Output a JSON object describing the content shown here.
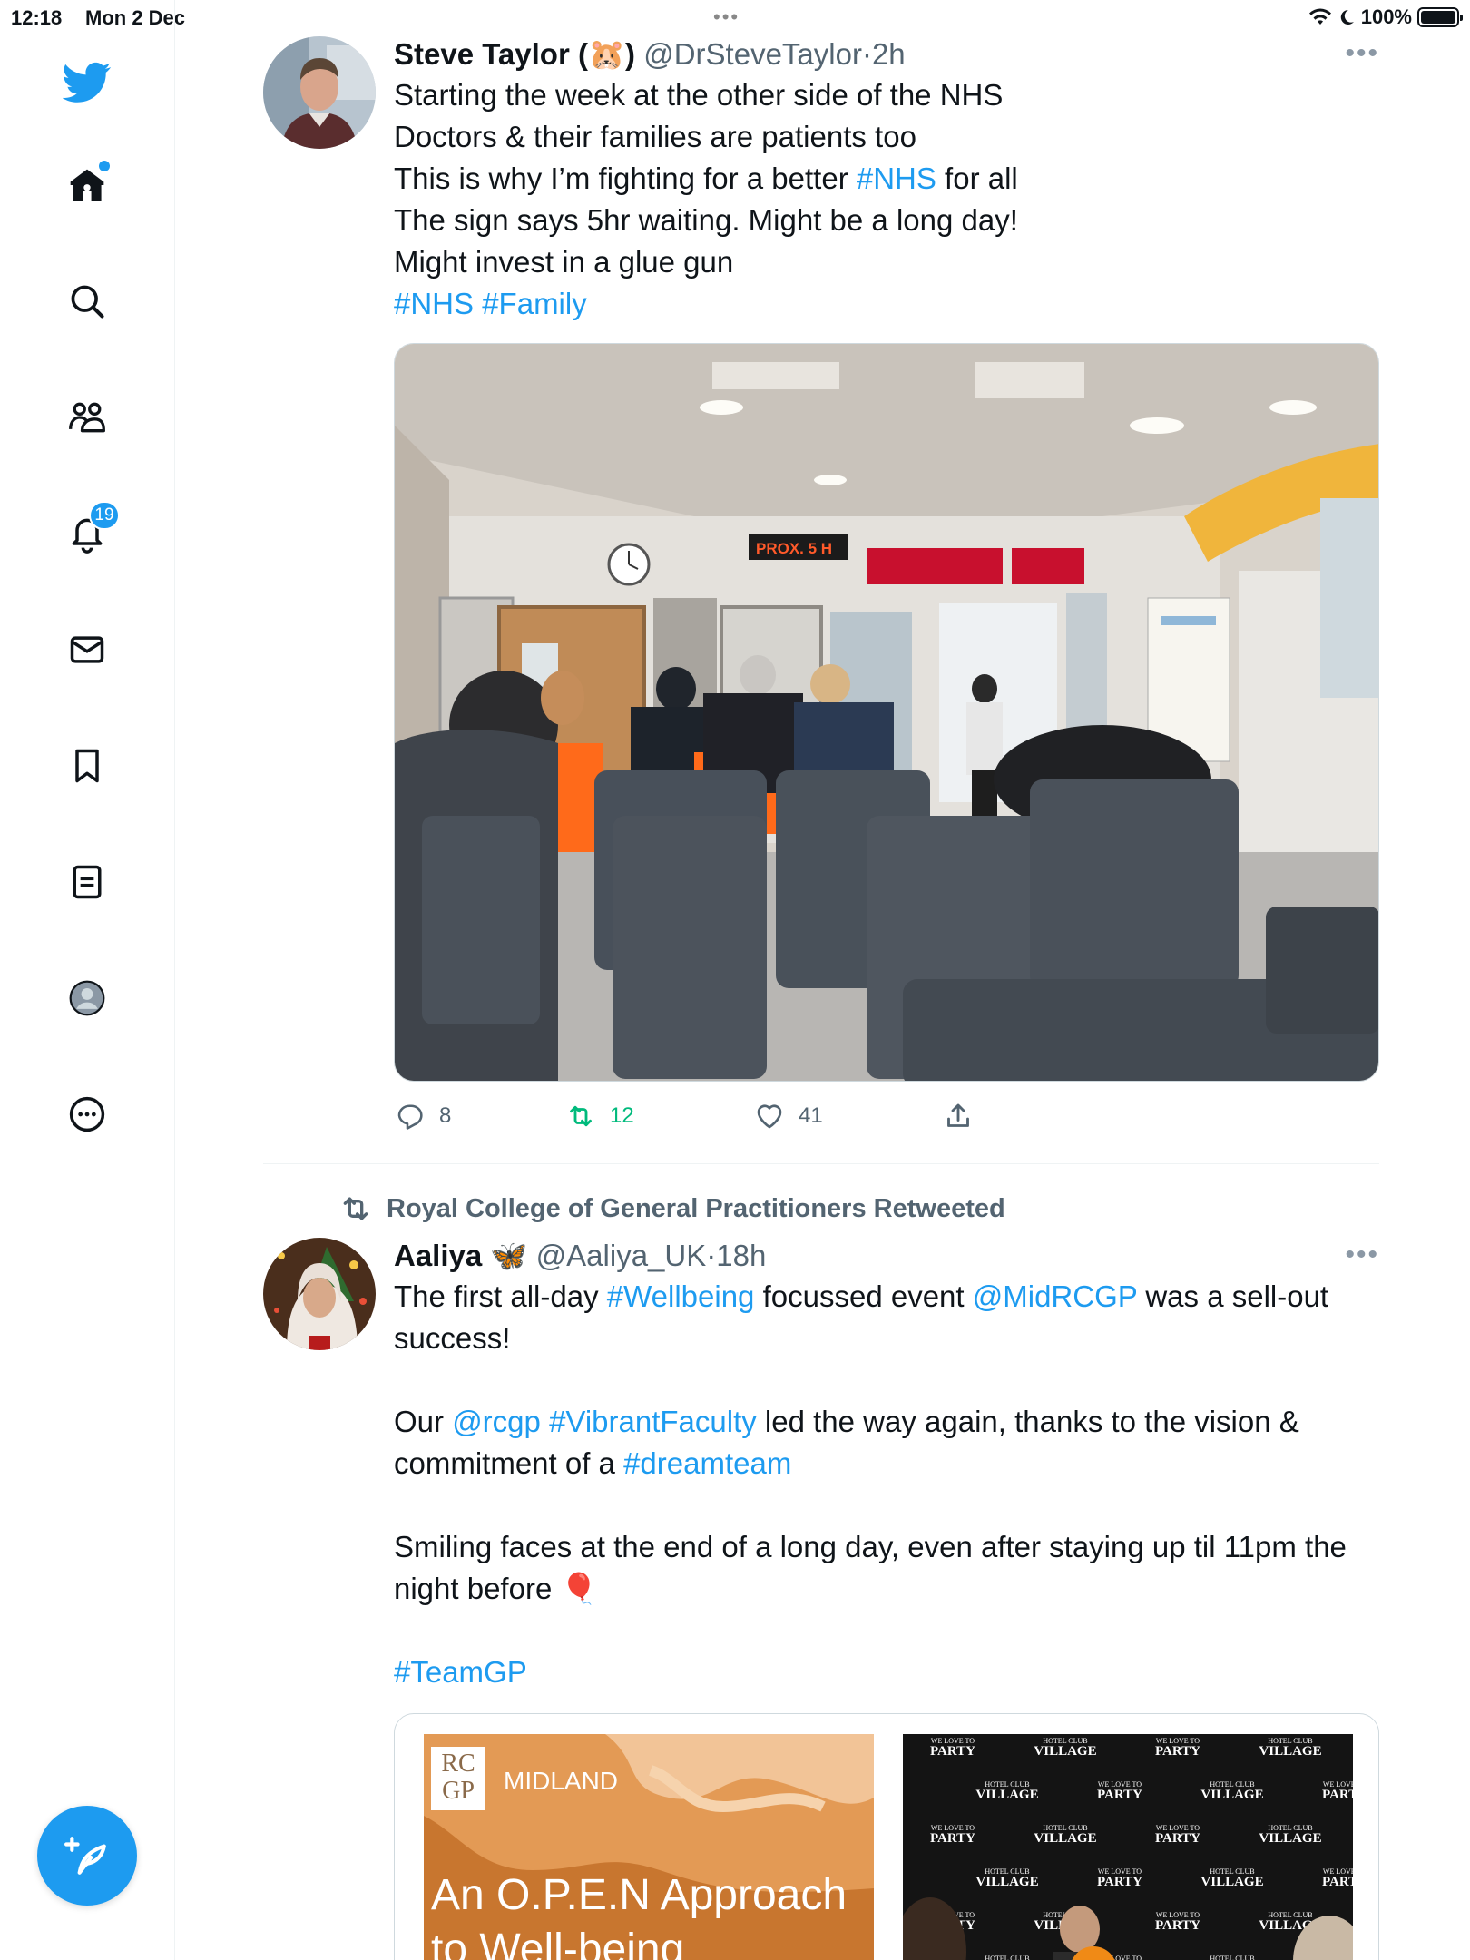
{
  "status_bar": {
    "time": "12:18",
    "date": "Mon 2 Dec",
    "battery": "100%",
    "dots": "•••"
  },
  "sidebar": {
    "items": [
      {
        "name": "twitter-logo-icon"
      },
      {
        "name": "home-icon"
      },
      {
        "name": "search-icon"
      },
      {
        "name": "communities-icon"
      },
      {
        "name": "notifications-icon",
        "badge": "19"
      },
      {
        "name": "messages-icon"
      },
      {
        "name": "bookmarks-icon"
      },
      {
        "name": "lists-icon"
      },
      {
        "name": "profile-icon"
      },
      {
        "name": "more-icon"
      }
    ],
    "compose_icon": "compose-icon"
  },
  "colors": {
    "accent": "#1d9bf0",
    "retweet": "#00ba7c",
    "secondary_text": "#536471"
  },
  "tweets": [
    {
      "name": "Steve Taylor (🐹)",
      "handle": "@DrSteveTaylor",
      "sep": "·",
      "time": "2h",
      "more": "•••",
      "lines": [
        [
          {
            "t": "Starting the week at the other side of the NHS"
          }
        ],
        [
          {
            "t": "Doctors & their families are patients too"
          }
        ],
        [
          {
            "t": "This is why I’m fighting for a better "
          },
          {
            "t": "#NHS",
            "tag": true
          },
          {
            "t": " for all"
          }
        ],
        [
          {
            "t": "The sign says 5hr waiting. Might be a long day!"
          }
        ],
        [
          {
            "t": "Might invest in a glue gun"
          }
        ],
        [
          {
            "t": "#NHS",
            "tag": true
          },
          {
            "t": " "
          },
          {
            "t": "#Family",
            "tag": true
          }
        ]
      ],
      "media_sign": "PROX. 5 H",
      "actions": {
        "replies": "8",
        "retweets": "12",
        "likes": "41"
      }
    },
    {
      "retweeted_by": "Royal College of General Practitioners Retweeted",
      "name": "Aaliya 🦋",
      "handle": "@Aaliya_UK",
      "sep": "·",
      "time": "18h",
      "more": "•••",
      "lines": [
        [
          {
            "t": "The first all-day "
          },
          {
            "t": "#Wellbeing",
            "tag": true
          },
          {
            "t": " focussed event "
          },
          {
            "t": "@MidRCGP",
            "tag": true
          },
          {
            "t": " was a sell-out"
          }
        ],
        [
          {
            "t": "success!"
          }
        ],
        [
          {
            "t": ""
          }
        ],
        [
          {
            "t": "Our "
          },
          {
            "t": "@rcgp",
            "tag": true
          },
          {
            "t": " "
          },
          {
            "t": "#VibrantFaculty",
            "tag": true
          },
          {
            "t": " led the way again, thanks to the vision &"
          }
        ],
        [
          {
            "t": "commitment of a "
          },
          {
            "t": "#dreamteam",
            "tag": true
          }
        ],
        [
          {
            "t": ""
          }
        ],
        [
          {
            "t": "Smiling faces at the end of a long day, even after staying up til 11pm the"
          }
        ],
        [
          {
            "t": "night before 🎈"
          }
        ],
        [
          {
            "t": ""
          }
        ],
        [
          {
            "t": "#TeamGP",
            "tag": true
          }
        ]
      ],
      "card": {
        "logo_top": "RC",
        "logo_bottom": "GP",
        "region": "MIDLAND",
        "headline_1": "An O.P.E.N Approach",
        "headline_2": "to Well-being",
        "banner_small": "WE LOVE TO",
        "banner_party": "PARTY",
        "banner_village": "VILLAGE",
        "banner_hotel": "HOTEL CLUB"
      }
    }
  ]
}
